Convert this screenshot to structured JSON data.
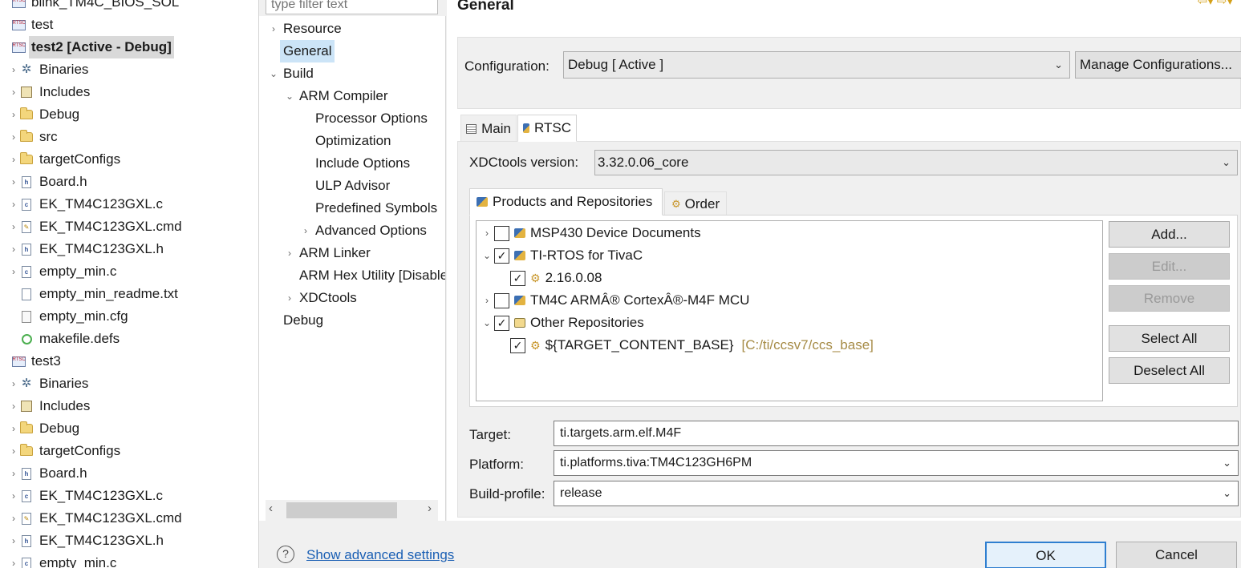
{
  "explorer": {
    "rows": [
      {
        "label": "blink_TM4C_BIOS_SOL",
        "arrow": "",
        "icon": "project"
      },
      {
        "label": "test",
        "arrow": "",
        "icon": "project"
      },
      {
        "label": "test2  [Active - Debug]",
        "arrow": "",
        "icon": "project"
      },
      {
        "label": "Binaries",
        "arrow": "›",
        "icon": "gear"
      },
      {
        "label": "Includes",
        "arrow": "›",
        "icon": "lib"
      },
      {
        "label": "Debug",
        "arrow": "›",
        "icon": "folder"
      },
      {
        "label": "src",
        "arrow": "›",
        "icon": "folder"
      },
      {
        "label": "targetConfigs",
        "arrow": "›",
        "icon": "folder"
      },
      {
        "label": "Board.h",
        "arrow": "›",
        "icon": "file-h"
      },
      {
        "label": "EK_TM4C123GXL.c",
        "arrow": "›",
        "icon": "file-c"
      },
      {
        "label": "EK_TM4C123GXL.cmd",
        "arrow": "›",
        "icon": "file-cmd"
      },
      {
        "label": "EK_TM4C123GXL.h",
        "arrow": "›",
        "icon": "file-h"
      },
      {
        "label": "empty_min.c",
        "arrow": "›",
        "icon": "file-c"
      },
      {
        "label": "empty_min_readme.txt",
        "arrow": "",
        "icon": "file-txt"
      },
      {
        "label": "empty_min.cfg",
        "arrow": "",
        "icon": "file-cfg"
      },
      {
        "label": "makefile.defs",
        "arrow": "",
        "icon": "defs"
      },
      {
        "label": "test3",
        "arrow": "",
        "icon": "project"
      },
      {
        "label": "Binaries",
        "arrow": "›",
        "icon": "gear"
      },
      {
        "label": "Includes",
        "arrow": "›",
        "icon": "lib"
      },
      {
        "label": "Debug",
        "arrow": "›",
        "icon": "folder"
      },
      {
        "label": "targetConfigs",
        "arrow": "›",
        "icon": "folder"
      },
      {
        "label": "Board.h",
        "arrow": "›",
        "icon": "file-h"
      },
      {
        "label": "EK_TM4C123GXL.c",
        "arrow": "›",
        "icon": "file-c"
      },
      {
        "label": "EK_TM4C123GXL.cmd",
        "arrow": "›",
        "icon": "file-cmd"
      },
      {
        "label": "EK_TM4C123GXL.h",
        "arrow": "›",
        "icon": "file-h"
      },
      {
        "label": "empty_min.c",
        "arrow": "›",
        "icon": "file-c"
      }
    ]
  },
  "filter": {
    "placeholder": "type filter text"
  },
  "nav": {
    "items": [
      {
        "label": "Resource",
        "arrow": "›"
      },
      {
        "label": "General",
        "arrow": ""
      },
      {
        "label": "Build",
        "arrow": "⌄"
      },
      {
        "label": "ARM Compiler",
        "arrow": "⌄"
      },
      {
        "label": "Processor Options",
        "arrow": ""
      },
      {
        "label": "Optimization",
        "arrow": ""
      },
      {
        "label": "Include Options",
        "arrow": ""
      },
      {
        "label": "ULP Advisor",
        "arrow": ""
      },
      {
        "label": "Predefined Symbols",
        "arrow": ""
      },
      {
        "label": "Advanced Options",
        "arrow": "›"
      },
      {
        "label": "ARM Linker",
        "arrow": "›"
      },
      {
        "label": "ARM Hex Utility  [Disabled]",
        "arrow": ""
      },
      {
        "label": "XDCtools",
        "arrow": "›"
      },
      {
        "label": "Debug",
        "arrow": ""
      }
    ]
  },
  "page": {
    "title": "General"
  },
  "config": {
    "label": "Configuration:",
    "value": "Debug  [ Active ]",
    "manage_label": "Manage Configurations..."
  },
  "tabs": {
    "main": "Main",
    "rtsc": "RTSC"
  },
  "rtsc": {
    "xdc_label": "XDCtools version:",
    "xdc_value": "3.32.0.06_core",
    "products_tab": "Products and Repositories",
    "order_tab": "Order",
    "repos": [
      {
        "label": "MSP430 Device Documents",
        "checked": false,
        "arrow": "›"
      },
      {
        "label": "TI-RTOS for TivaC",
        "checked": true,
        "arrow": "⌄"
      },
      {
        "label": "2.16.0.08",
        "checked": true,
        "arrow": ""
      },
      {
        "label": "TM4C ARMÂ® CortexÂ®-M4F MCU",
        "checked": false,
        "arrow": "›"
      },
      {
        "label": "Other Repositories",
        "checked": true,
        "arrow": "⌄"
      },
      {
        "label": "${TARGET_CONTENT_BASE}",
        "checked": true,
        "arrow": "",
        "hint": "[C:/ti/ccsv7/ccs_base]"
      }
    ],
    "buttons": {
      "add": "Add...",
      "edit": "Edit...",
      "remove": "Remove",
      "select_all": "Select All",
      "deselect_all": "Deselect All"
    },
    "target_label": "Target:",
    "target_value": "ti.targets.arm.elf.M4F",
    "platform_label": "Platform:",
    "platform_value": "ti.platforms.tiva:TM4C123GH6PM",
    "profile_label": "Build-profile:",
    "profile_value": "release"
  },
  "footer": {
    "help": "?",
    "advanced_link": "Show advanced settings",
    "ok": "OK",
    "cancel": "Cancel"
  }
}
